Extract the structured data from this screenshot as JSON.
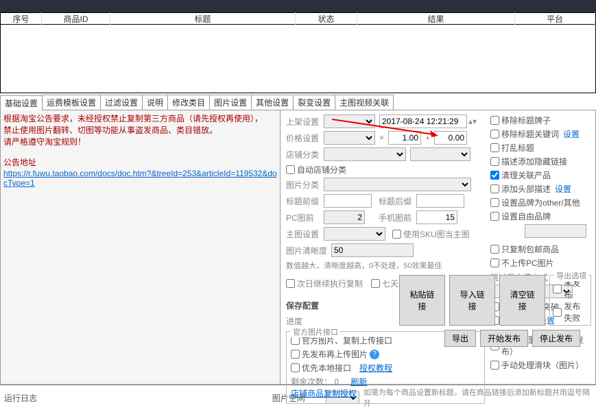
{
  "table": {
    "cols": [
      "序号",
      "商品ID",
      "标题",
      "状态",
      "结果",
      "平台"
    ]
  },
  "tabs": [
    "基础设置",
    "运费模板设置",
    "过滤设置",
    "说明",
    "修改类目",
    "图片设置",
    "其他设置",
    "裂变设置",
    "主图视频关联"
  ],
  "notice": {
    "l1": "根据淘宝公告要求，未经授权禁止复制第三方商品（请先授权再使用），",
    "l2": "禁止使用图片翻转、切图等功能从事盗发商品、类目错放。",
    "l3": "请严格遵守淘宝规则！",
    "l4": "公告地址",
    "url": "https://r.fuwu.taobao.com/docs/doc.htm?&treeId=253&articleId=119532&docType=1"
  },
  "mid": {
    "上架设置": "上架设置",
    "datetime": "2017-08-24 12:21:29",
    "价格设置": "价格设置",
    "mult": "×",
    "price": "1.00",
    "plus": "+",
    "add": "0.00",
    "店铺分类": "店铺分类",
    "自动店铺分类": "自动店铺分类",
    "图片分类": "图片分类",
    "标题前缀": "标题前缀",
    "标题后缀": "标题后缀",
    "PC图前": "PC图前",
    "pcval": "2",
    "手机图前": "手机图前",
    "mobval": "15",
    "主图设置": "主图设置",
    "使用SKU图当主图": "使用SKU图当主图",
    "图片清晰度": "图片清晰度",
    "clarity": "50",
    "clarity_hint": "数值越大，清晰度越高，0不处理，50效果最佳",
    "次日继续执行复制": "次日继续执行复制",
    "七天无理由退货": "七天无理由退货",
    "保存配置": "保存配置",
    "进度": "进度",
    "官方图片接口": "官方图片接口",
    "官方图片复制上传接口": "官方图片、复制上传接口",
    "先发布再上传图片": "先发布再上传图片",
    "优先本地接口": "优先本地接口",
    "授权教程": "授权教程",
    "剩余次数": "剩余次数：",
    "remain": "0",
    "刷新": "刷新",
    "店铺商品复制授权": "店铺商品复制授权"
  },
  "side": {
    "移除标题牌子": "移除标题牌子",
    "移除标题关键词": "移除标题关键词",
    "设置": "设置",
    "打乱标题": "打乱标题",
    "描述添加隐藏链接": "描述添加隐藏链接",
    "清理关联产品": "清理关联产品",
    "添加头部描述": "添加头部描述",
    "设置品牌为other其他": "设置品牌为other/其他",
    "设置自由品牌": "设置自由品牌",
    "只复制包邮商品": "只复制包邮商品",
    "不上传PC图片": "不上传PC图片",
    "跳过已上传方式": "跳过已上传方式",
    "回收站翻新突破": "回收站翻新突破",
    "仓库突破": "仓库突破",
    "手动处理滑块商品发布": "手动处理滑块（商品发布）",
    "手动处理滑块图片": "手动处理滑块（图片）",
    "导出选项": "导出选项",
    "未发布": "未发布",
    "发布失败": "发布失败"
  },
  "btns": {
    "粘贴链接": "粘贴链接",
    "导入链接": "导入链接",
    "清空链接": "清空链接",
    "导出": "导出",
    "开始发布": "开始发布",
    "停止发布": "停止发布"
  },
  "footer": {
    "运行日志": "运行日志",
    "图片空间": "图片空间",
    "hint": "如需为每个商品设置新标题，请在商品链接后添加新标题并用逗号隔开"
  }
}
